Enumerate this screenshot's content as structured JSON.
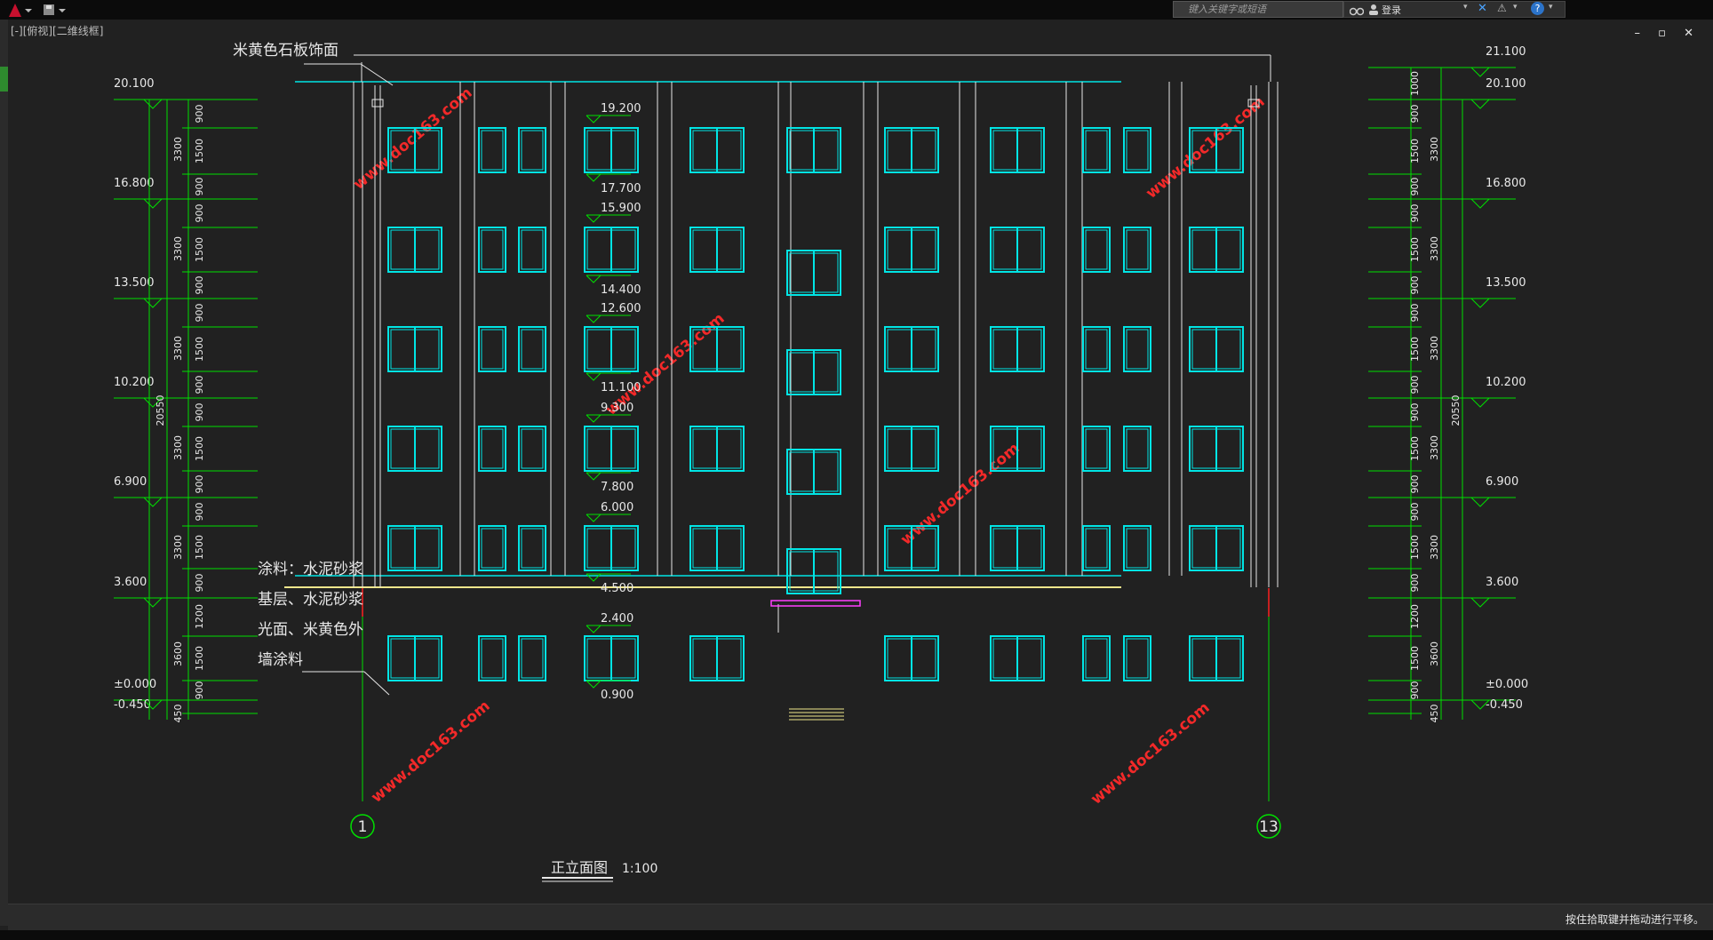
{
  "toolbar": {
    "search_placeholder": "键入关键字或短语",
    "login_label": "登录",
    "help_label": "?"
  },
  "viewport_label": "[-][俯视][二维线框]",
  "window_controls": "– ▫ ✕",
  "status_message": "按住拾取键并拖动进行平移。",
  "drawing": {
    "title": "正立面图",
    "scale": "1:100",
    "material_note_top": "米黄色石板饰面",
    "material_note_lines": [
      "涂料：水泥砂浆",
      "基层、水泥砂浆",
      "光面、米黄色外",
      "墙涂料"
    ],
    "axis_left": "1",
    "axis_right": "13",
    "watermark": "www.doc163.com",
    "left_elevations": [
      "20.100",
      "16.800",
      "13.500",
      "10.200",
      "6.900",
      "3.600",
      "±0.000",
      "-0.450"
    ],
    "right_elevations": [
      "21.100",
      "20.100",
      "16.800",
      "13.500",
      "10.200",
      "6.900",
      "3.600",
      "±0.000",
      "-0.450"
    ],
    "center_elevations": [
      "19.200",
      "17.700",
      "15.900",
      "14.400",
      "12.600",
      "11.100",
      "9.300",
      "7.800",
      "6.000",
      "4.500",
      "2.400",
      "0.900"
    ],
    "left_dims_outer": [
      "3300",
      "3300",
      "3300",
      "3300",
      "3300",
      "3600",
      "450"
    ],
    "left_dims_inner": [
      "900",
      "1500",
      "900",
      "900",
      "1500",
      "900",
      "900",
      "1500",
      "900",
      "900",
      "1500",
      "900",
      "900",
      "1500",
      "900",
      "1200",
      "1500",
      "900"
    ],
    "right_dims_outer": [
      "3300",
      "3300",
      "3300",
      "3300",
      "3300",
      "3600",
      "450"
    ],
    "right_dims_inner": [
      "1000",
      "900",
      "1500",
      "900",
      "900",
      "1500",
      "900",
      "900",
      "1500",
      "900",
      "900",
      "1500",
      "900",
      "900",
      "1500",
      "900",
      "1200",
      "1500",
      "900"
    ],
    "total_height": "20550",
    "colors": {
      "background": "#212121",
      "window": "#00e5e5",
      "dimension": "#00e000",
      "outline": "#e8e8e8",
      "ground": "#f0e68c",
      "accent": "#ff40ff",
      "axis_line": "#ff2020",
      "watermark": "#ff2a2a"
    }
  }
}
